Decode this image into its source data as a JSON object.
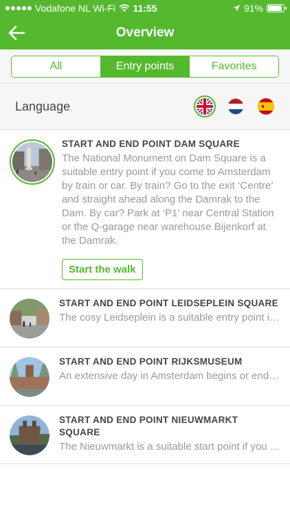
{
  "status": {
    "carrier": "Vodafone NL Wi-Fi",
    "time": "11:55",
    "battery": "91%",
    "battery_level": 0.91
  },
  "nav": {
    "title": "Overview",
    "back_icon": "arrow-left-icon"
  },
  "tabs": [
    {
      "label": "All",
      "active": false
    },
    {
      "label": "Entry points",
      "active": true
    },
    {
      "label": "Favorites",
      "active": false
    }
  ],
  "language": {
    "label": "Language",
    "flags": [
      {
        "name": "uk-flag-icon",
        "selected": true
      },
      {
        "name": "netherlands-flag-icon",
        "selected": false
      },
      {
        "name": "spain-flag-icon",
        "selected": false
      }
    ]
  },
  "items": [
    {
      "title": "START AND END POINT DAM SQUARE",
      "desc": "The National Monument on Dam Square is a suitable entry point if you come to Amsterdam by train or car. By train? Go to the exit ‘Centre’ and straight ahead along the Damrak to the Dam. By car? Park at ‘P1’ near Central Station or the Q-garage near warehouse Bijenkorf at the Damrak.",
      "button": "Start the walk",
      "expanded": true
    },
    {
      "title": "START AND END POINT LEIDSEPLEIN SQUARE",
      "desc": "The cosy Leidseplein is a suitable entry point in the lively center. Stop Leidseplein is accessible by tram.",
      "expanded": false
    },
    {
      "title": "START AND END POINT RIJKSMUSEUM",
      "desc": "An extensive day in Amsterdam begins or ends with a visit to the Rijksmuseum. The entrance is on the Museumplein.",
      "expanded": false
    },
    {
      "title": "START AND END POINT NIEUWMARKT SQUARE",
      "desc": "The Nieuwmarkt is a suitable start point if you are travelling by car, and parked at P+R Zeeburg.",
      "expanded": false
    }
  ],
  "colors": {
    "accent": "#54b92e",
    "muted_text": "#9a9a9a"
  }
}
